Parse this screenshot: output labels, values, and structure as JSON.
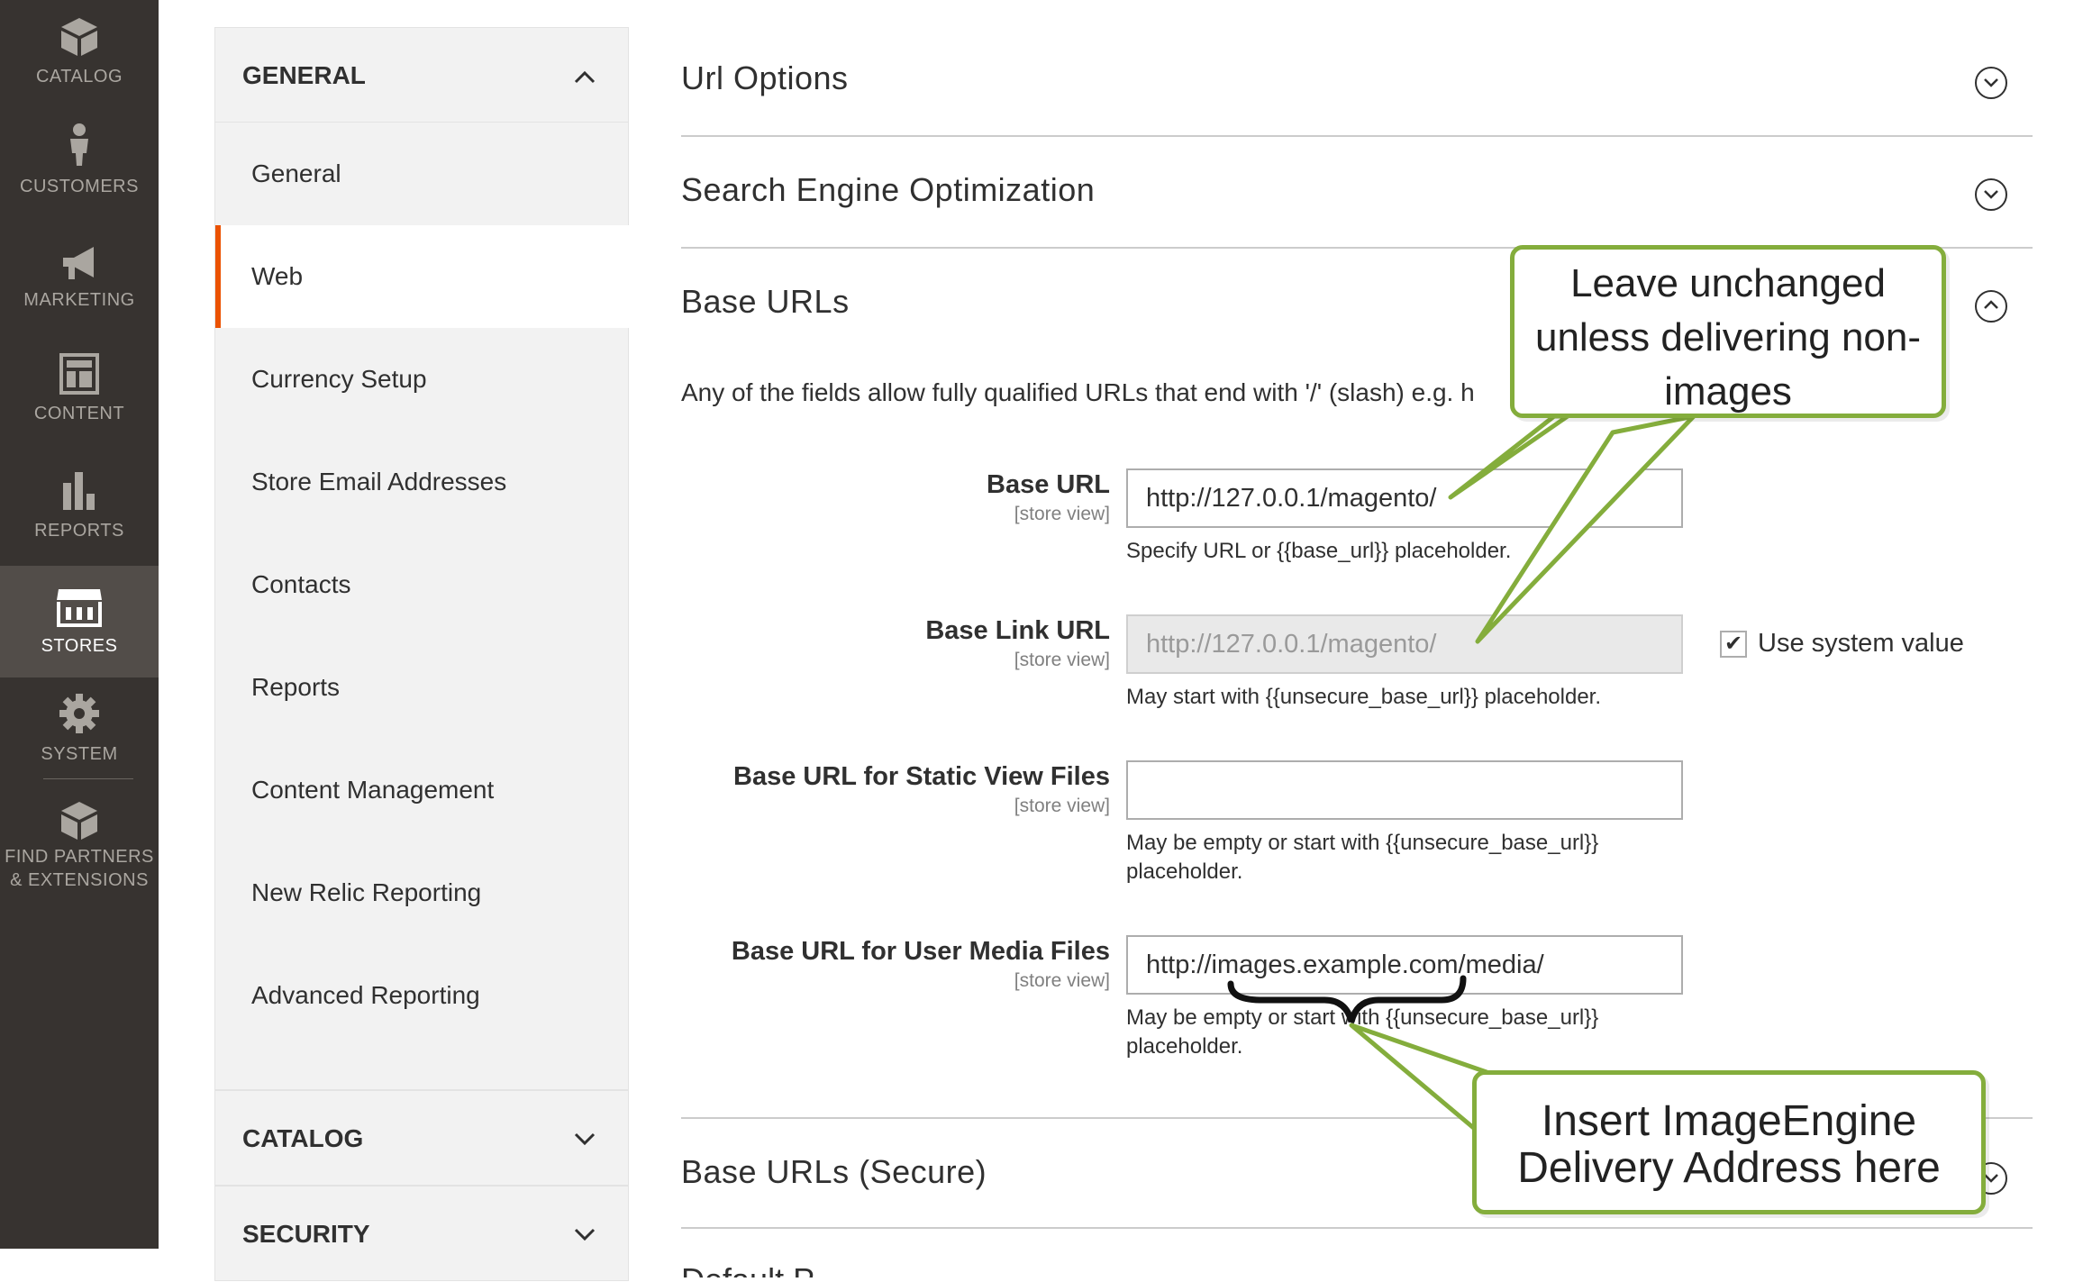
{
  "nav": {
    "catalog": "CATALOG",
    "customers": "CUSTOMERS",
    "marketing": "MARKETING",
    "content": "CONTENT",
    "reports": "REPORTS",
    "stores": "STORES",
    "system": "SYSTEM",
    "partners_line1": "FIND PARTNERS",
    "partners_line2": "& EXTENSIONS"
  },
  "tabs": {
    "general_group": "GENERAL",
    "items": [
      "General",
      "Web",
      "Currency Setup",
      "Store Email Addresses",
      "Contacts",
      "Reports",
      "Content Management",
      "New Relic Reporting",
      "Advanced Reporting"
    ],
    "active_item": "Web",
    "catalog_group": "CATALOG",
    "security_group": "SECURITY"
  },
  "sections": {
    "url_options": "Url Options",
    "seo": "Search Engine Optimization",
    "base_urls": "Base URLs",
    "base_urls_secure": "Base URLs (Secure)",
    "default_pages": "Default P..."
  },
  "base_urls": {
    "description": "Any of the fields allow fully qualified URLs that end with '/' (slash) e.g. h",
    "scope": "[store view]",
    "base_url": {
      "label": "Base URL",
      "value": "http://127.0.0.1/magento/",
      "note": "Specify URL or {{base_url}} placeholder."
    },
    "base_link_url": {
      "label": "Base Link URL",
      "value": "http://127.0.0.1/magento/",
      "note": "May start with {{unsecure_base_url}} placeholder.",
      "use_system_value": "Use system value",
      "use_system_checked": true
    },
    "static_url": {
      "label": "Base URL for Static View Files",
      "value": "",
      "note_line1": "May be empty or start with {{unsecure_base_url}}",
      "note_line2": "placeholder."
    },
    "media_url": {
      "label": "Base URL for User Media Files",
      "value": "http://images.example.com/media/",
      "note_line1": "May be empty or start with {{unsecure_base_url}}",
      "note_line2": "placeholder."
    }
  },
  "callouts": {
    "top_line1": "Leave unchanged",
    "top_line2": "unless delivering non-",
    "top_line3": "images",
    "bottom_line1": "Insert ImageEngine",
    "bottom_line2": "Delivery Address here"
  },
  "colors": {
    "nav_bg": "#373330",
    "nav_active": "#524d49",
    "accent": "#eb5202",
    "callout_border": "#84ad3c"
  }
}
